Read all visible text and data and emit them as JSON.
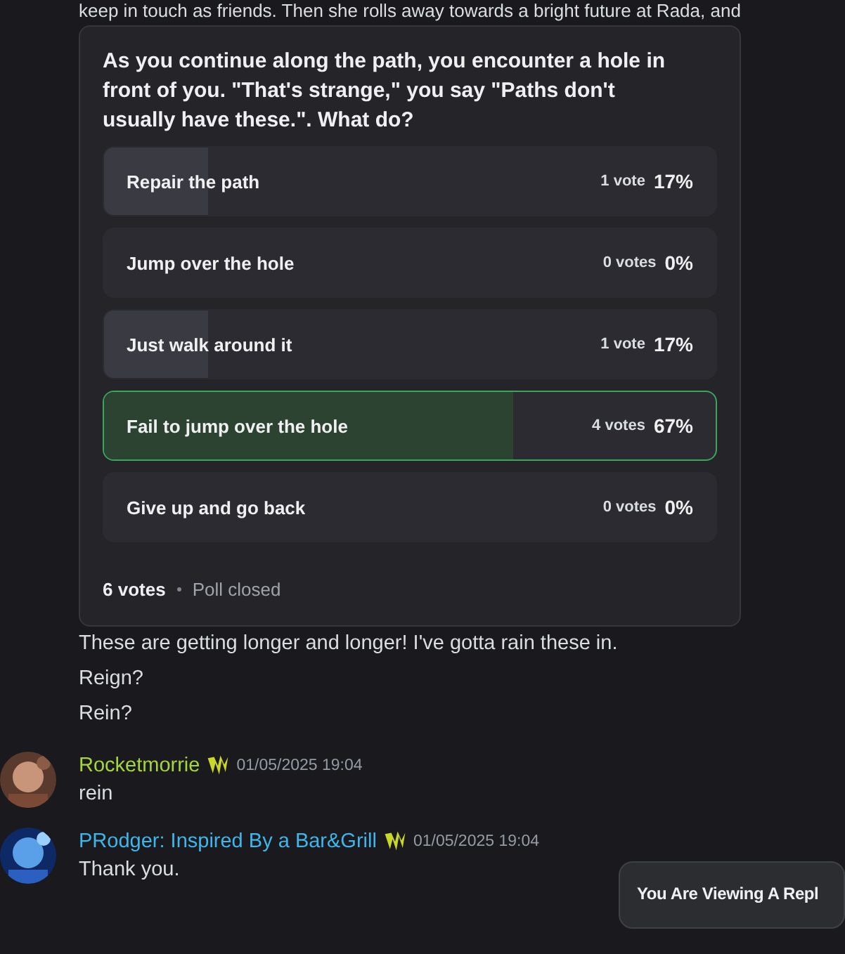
{
  "top_text": "keep in touch as friends. Then she rolls away towards a bright future at Rada, and",
  "poll": {
    "question": "As you continue along the path, you encounter a hole in front of you. \"That's strange,\" you say \"Paths don't usually have these.\". What do?",
    "options": [
      {
        "label": "Repair the path",
        "votes": "1 vote",
        "percent": "17%",
        "level": 0.17,
        "selected": false
      },
      {
        "label": "Jump over the hole",
        "votes": "0 votes",
        "percent": "0%",
        "selected": false
      },
      {
        "label": "Just walk around it",
        "votes": "1 vote",
        "percent": "17%",
        "level": 0.17,
        "selected": false
      },
      {
        "label": "Fail to jump over the hole",
        "votes": "4 votes",
        "percent": "67%",
        "level": 0.67,
        "selected": true
      },
      {
        "label": "Give up and go back",
        "votes": "0 votes",
        "percent": "0%",
        "selected": false
      }
    ],
    "total": "6 votes",
    "status": "Poll closed"
  },
  "lines": [
    "These are getting longer and longer! I've gotta rain these in.",
    "Reign?",
    "Rein?"
  ],
  "messages": [
    {
      "author": "Rocketmorrie",
      "color": "#a3d63c",
      "timestamp": "01/05/2025 19:04",
      "text": "rein"
    },
    {
      "author": "PRodger: Inspired By a Bar&Grill",
      "color": "#3fb6ea",
      "timestamp": "01/05/2025 19:04",
      "text": "Thank you."
    }
  ],
  "toast": "You Are Viewing A Repl"
}
